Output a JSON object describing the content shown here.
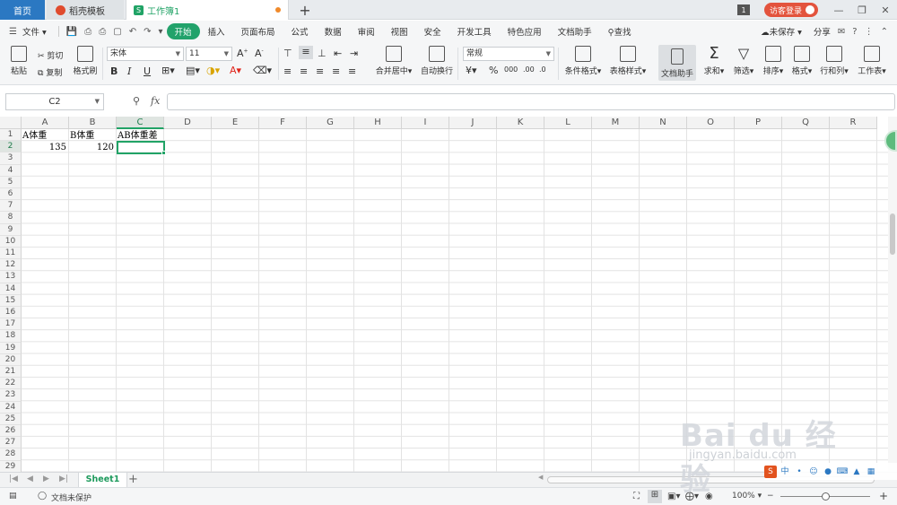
{
  "tabs": {
    "home": "首页",
    "template": "稻壳模板",
    "workbook": "工作簿1",
    "add": "+"
  },
  "titlebar": {
    "badge": "1",
    "login": "访客登录"
  },
  "menu": {
    "file": "文件",
    "items": [
      "开始",
      "插入",
      "页面布局",
      "公式",
      "数据",
      "审阅",
      "视图",
      "安全",
      "开发工具",
      "特色应用",
      "文档助手"
    ],
    "search": "查找",
    "unsaved": "未保存",
    "share": "分享",
    "help": "?"
  },
  "ribbon": {
    "paste": "粘贴",
    "cut": "剪切",
    "copy": "复制",
    "format_painter": "格式刷",
    "font_name": "宋体",
    "font_size": "11",
    "merge_center": "合并居中",
    "wrap_text": "自动换行",
    "number_format": "常规",
    "conditional_format": "条件格式",
    "table_style": "表格样式",
    "doc_helper": "文档助手",
    "sum": "求和",
    "filter": "筛选",
    "sort": "排序",
    "format": "格式",
    "row_col": "行和列",
    "worksheet": "工作表"
  },
  "formula_bar": {
    "name_box": "C2",
    "fx": "fx",
    "value": ""
  },
  "sheet": {
    "columns": [
      "A",
      "B",
      "C",
      "D",
      "E",
      "F",
      "G",
      "H",
      "I",
      "J",
      "K",
      "L",
      "M",
      "N",
      "O",
      "P",
      "Q",
      "R"
    ],
    "row_count": 29,
    "cells": {
      "A1": "A体重",
      "B1": "B体重",
      "C1": "AB体重差",
      "A2": "135",
      "B2": "120"
    },
    "active_cell": "C2"
  },
  "sheet_tabs": {
    "active": "Sheet1",
    "add": "+"
  },
  "statusbar": {
    "protection": "文档未保护",
    "zoom": "100%"
  },
  "watermark": {
    "text": "Bai du 经验",
    "url": "jingyan.baidu.com"
  }
}
